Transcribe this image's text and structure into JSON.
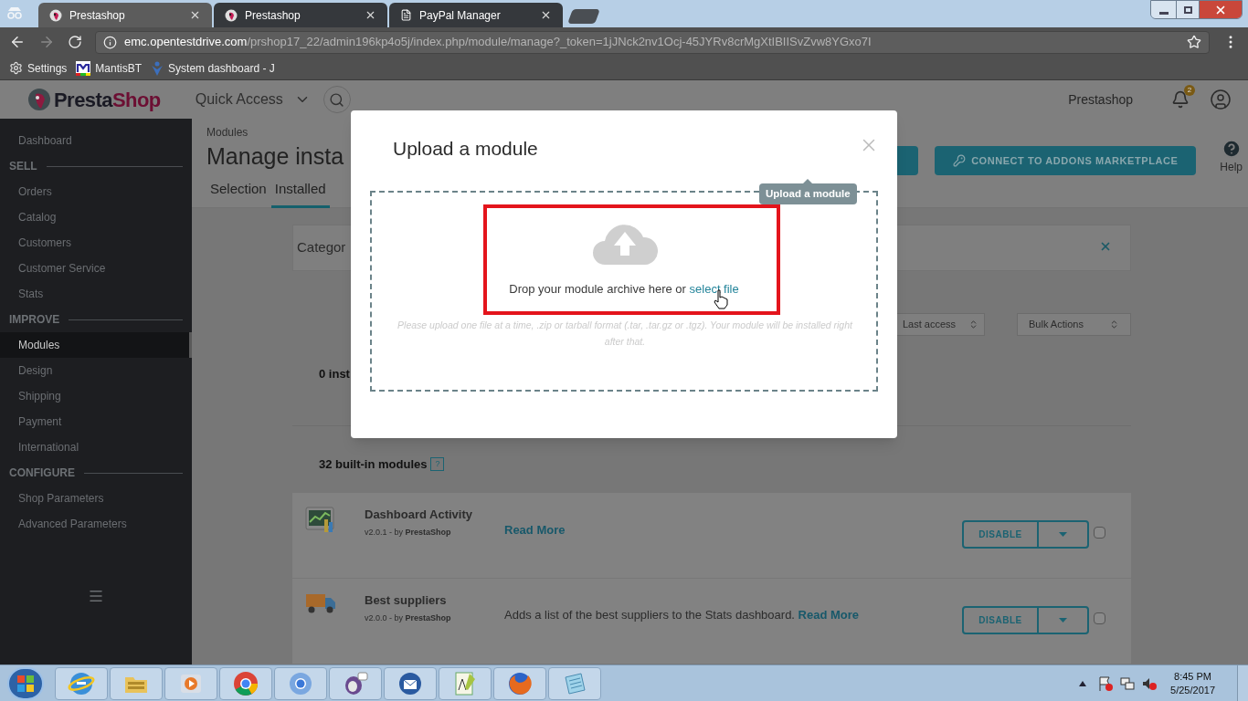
{
  "browser": {
    "tabs": [
      {
        "title": "Prestashop",
        "selected": true,
        "kind": "shop"
      },
      {
        "title": "Prestashop",
        "selected": false,
        "kind": "shop"
      },
      {
        "title": "PayPal Manager",
        "selected": false,
        "kind": "page"
      }
    ],
    "url": {
      "host": "emc.opentestdrive.com",
      "path": "/prshop17_22/admin196kp4o5j/index.php/module/manage?_token=1jJNck2nv1Ocj-45JYRv8crMgXtIBIISvZvw8YGxo7I"
    },
    "bookmarks": [
      {
        "label": "Settings",
        "kind": "gear"
      },
      {
        "label": "MantisBT",
        "kind": "mantis"
      },
      {
        "label": "System dashboard - J",
        "kind": "jira"
      }
    ]
  },
  "header": {
    "logo_parts": [
      "Presta",
      "Shop"
    ],
    "quick_access": "Quick Access",
    "shop_name": "Prestashop",
    "notifications": "2"
  },
  "sidebar": [
    {
      "kind": "item",
      "label": "Dashboard",
      "selected": false
    },
    {
      "kind": "section",
      "label": "SELL"
    },
    {
      "kind": "item",
      "label": "Orders",
      "selected": false
    },
    {
      "kind": "item",
      "label": "Catalog",
      "selected": false
    },
    {
      "kind": "item",
      "label": "Customers",
      "selected": false
    },
    {
      "kind": "item",
      "label": "Customer Service",
      "selected": false
    },
    {
      "kind": "item",
      "label": "Stats",
      "selected": false
    },
    {
      "kind": "section",
      "label": "IMPROVE"
    },
    {
      "kind": "item",
      "label": "Modules",
      "selected": true
    },
    {
      "kind": "item",
      "label": "Design",
      "selected": false
    },
    {
      "kind": "item",
      "label": "Shipping",
      "selected": false
    },
    {
      "kind": "item",
      "label": "Payment",
      "selected": false
    },
    {
      "kind": "item",
      "label": "International",
      "selected": false
    },
    {
      "kind": "section",
      "label": "CONFIGURE"
    },
    {
      "kind": "item",
      "label": "Shop Parameters",
      "selected": false
    },
    {
      "kind": "item",
      "label": "Advanced Parameters",
      "selected": false
    }
  ],
  "page": {
    "breadcrumb": "Modules",
    "title": "Manage insta",
    "tabs": [
      {
        "label": "Selection",
        "selected": false
      },
      {
        "label": "Installed",
        "selected": true
      }
    ],
    "marketplace_button": "CONNECT TO ADDONS MARKETPLACE",
    "help": "Help",
    "filter_label": "Categor",
    "sort_select": "Last access",
    "bulk_select": "Bulk Actions",
    "installed_count": "0 inst",
    "builtin_count": "32 built-in modules",
    "help_badge": "?",
    "modules": [
      {
        "name": "Dashboard Activity",
        "kind": "chart",
        "version": "v2.0.1 - by **PrestaShop**",
        "read_more": "Read More",
        "button": "DISABLE",
        "checked": false
      },
      {
        "name": "Best suppliers",
        "kind": "truck",
        "version": "v2.0.0 - by **PrestaShop**",
        "description": "Adds a list of the best suppliers to the Stats dashboard. ",
        "read_more": "Read More",
        "button": "DISABLE",
        "checked": false
      }
    ]
  },
  "modal": {
    "title": "Upload a module",
    "tooltip": "Upload a module",
    "drop_text": "Drop your module archive here or ",
    "select_link": "select file",
    "hint": "Please upload one file at a time, .zip or tarball format (.tar, .tar.gz or .tgz). Your module will be installed right after that."
  },
  "taskbar": {
    "time": "8:45 PM",
    "date": "5/25/2017"
  }
}
